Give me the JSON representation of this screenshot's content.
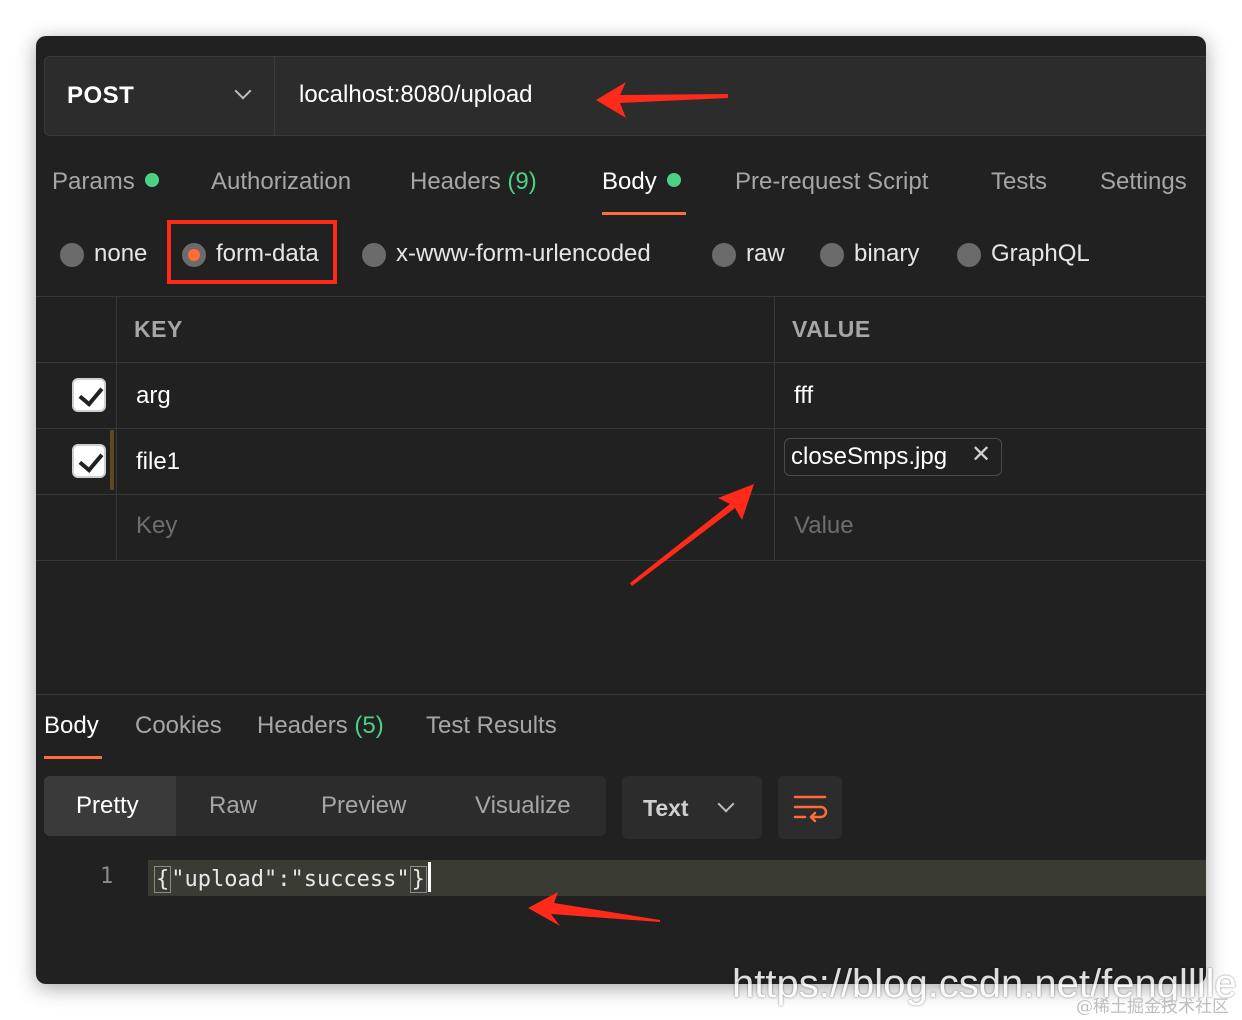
{
  "request": {
    "method": "POST",
    "url": "localhost:8080/upload"
  },
  "tabs": {
    "params": "Params",
    "authorization": "Authorization",
    "headers": "Headers",
    "headers_count": "(9)",
    "body": "Body",
    "pre_request": "Pre-request Script",
    "tests": "Tests",
    "settings": "Settings"
  },
  "body_types": {
    "none": "none",
    "form_data": "form-data",
    "urlencoded": "x-www-form-urlencoded",
    "raw": "raw",
    "binary": "binary",
    "graphql": "GraphQL",
    "selected": "form-data"
  },
  "table": {
    "key_header": "KEY",
    "value_header": "VALUE",
    "rows": [
      {
        "key": "arg",
        "value": "fff",
        "checked": true
      },
      {
        "key": "file1",
        "value": "closeSmps.jpg",
        "checked": true
      }
    ],
    "key_placeholder": "Key",
    "value_placeholder": "Value"
  },
  "response": {
    "tabs": {
      "body": "Body",
      "cookies": "Cookies",
      "headers": "Headers",
      "headers_count": "(5)",
      "test_results": "Test Results"
    },
    "views": {
      "pretty": "Pretty",
      "raw": "Raw",
      "preview": "Preview",
      "visualize": "Visualize"
    },
    "format": "Text",
    "line_number": "1",
    "code_open": "{",
    "code_body": "\"upload\":\"success\"",
    "code_close": "}"
  },
  "colors": {
    "accent": "#ff6c37",
    "status_green": "#4cd084",
    "annotation_red": "#ff2a1a"
  },
  "watermark": {
    "url": "https://blog.csdn.net/fenglllle",
    "credit": "@稀土掘金技术社区"
  }
}
